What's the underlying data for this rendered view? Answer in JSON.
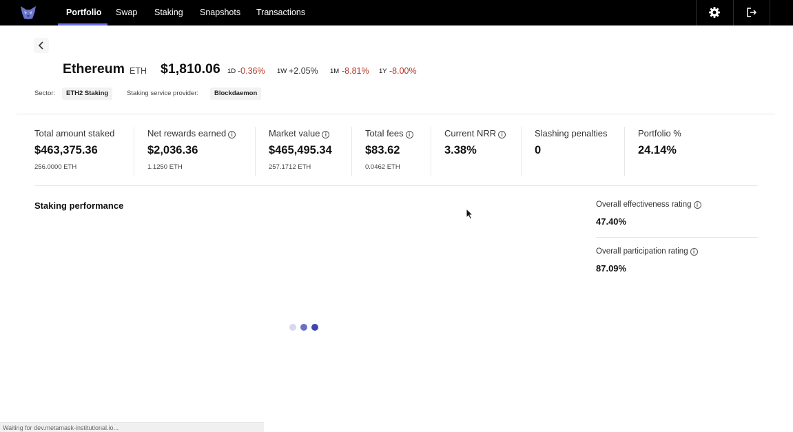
{
  "nav": {
    "items": [
      {
        "label": "Portfolio",
        "active": true
      },
      {
        "label": "Swap"
      },
      {
        "label": "Staking"
      },
      {
        "label": "Snapshots"
      },
      {
        "label": "Transactions"
      }
    ],
    "icons": [
      "fox-logo-icon",
      "gear-icon",
      "logout-icon"
    ],
    "accent_color": "#6a70e8"
  },
  "asset": {
    "name": "Ethereum",
    "symbol": "ETH",
    "price": "$1,810.06",
    "changes": [
      {
        "period": "1D",
        "value": "-0.36%",
        "negative": true
      },
      {
        "period": "1W",
        "value": "+2.05%",
        "negative": false
      },
      {
        "period": "1M",
        "value": "-8.81%",
        "negative": true
      },
      {
        "period": "1Y",
        "value": "-8.00%",
        "negative": true
      }
    ],
    "sector_label": "Sector:",
    "sector": "ETH2 Staking",
    "provider_label": "Staking service provider:",
    "provider": "Blockdaemon"
  },
  "stats": [
    {
      "label": "Total amount staked",
      "value": "$463,375.36",
      "sub": "256.0000 ETH",
      "info": false
    },
    {
      "label": "Net rewards earned",
      "value": "$2,036.36",
      "sub": "1.1250 ETH",
      "info": true
    },
    {
      "label": "Market value",
      "value": "$465,495.34",
      "sub": "257.1712 ETH",
      "info": true
    },
    {
      "label": "Total fees",
      "value": "$83.62",
      "sub": "0.0462 ETH",
      "info": true
    },
    {
      "label": "Current NRR",
      "value": "3.38%",
      "sub": "",
      "info": true
    },
    {
      "label": "Slashing penalties",
      "value": "0",
      "sub": "",
      "info": false
    },
    {
      "label": "Portfolio %",
      "value": "24.14%",
      "sub": "",
      "info": false
    }
  ],
  "performance": {
    "title": "Staking performance",
    "effectiveness_label": "Overall effectiveness rating",
    "effectiveness_value": "47.40%",
    "participation_label": "Overall participation rating",
    "participation_value": "87.09%"
  },
  "status_bar": "Waiting for dev.metamask-institutional.io..."
}
